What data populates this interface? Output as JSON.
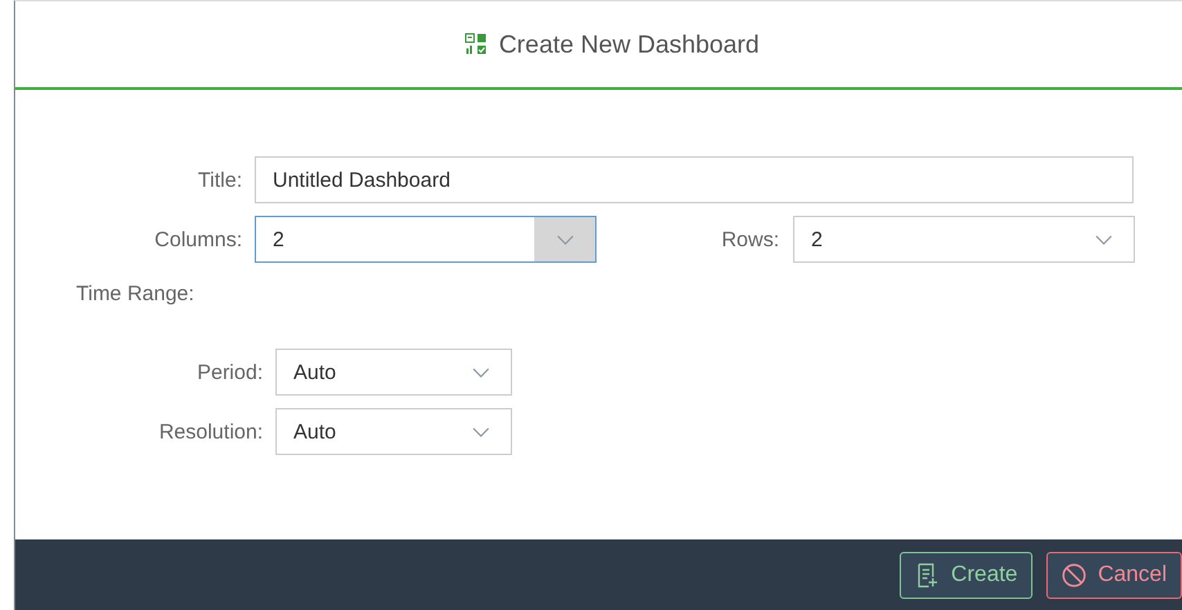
{
  "dialog": {
    "title": "Create New Dashboard"
  },
  "fields": [
    {
      "label": "Title:",
      "value": "Untitled Dashboard"
    }
  ],
  "grid": {
    "columns": {
      "label": "Columns:",
      "value": "2",
      "focused": true
    },
    "rows": {
      "label": "Rows:",
      "value": "2",
      "focused": false
    }
  },
  "time_range": {
    "label": "Time Range:",
    "selects": [
      {
        "label": "Period:",
        "value": "Auto"
      },
      {
        "label": "Resolution:",
        "value": "Auto"
      }
    ]
  },
  "buttons": [
    {
      "kind": "create",
      "label": "Create"
    },
    {
      "kind": "cancel",
      "label": "Cancel"
    }
  ]
}
